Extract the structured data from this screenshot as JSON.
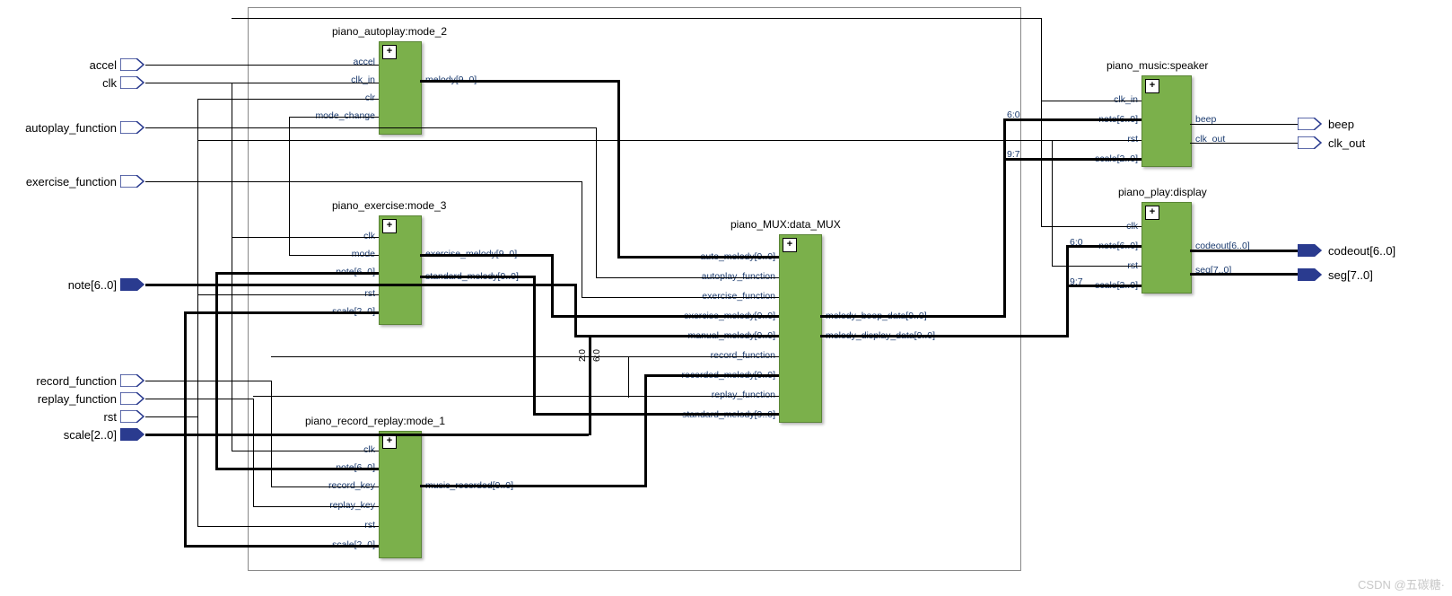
{
  "inputs": {
    "accel": "accel",
    "clk": "clk",
    "autoplay_function": "autoplay_function",
    "exercise_function": "exercise_function",
    "note": "note[6..0]",
    "record_function": "record_function",
    "replay_function": "replay_function",
    "rst": "rst",
    "scale": "scale[2..0]"
  },
  "outputs": {
    "beep": "beep",
    "clk_out": "clk_out",
    "codeout": "codeout[6..0]",
    "seg": "seg[7..0]"
  },
  "blocks": {
    "autoplay": {
      "title": "piano_autoplay:mode_2",
      "in": [
        "accel",
        "clk_in",
        "clr",
        "mode_change"
      ],
      "out": [
        "melody[9..0]"
      ]
    },
    "exercise": {
      "title": "piano_exercise:mode_3",
      "in": [
        "clk",
        "mode",
        "note[6..0]",
        "rst",
        "scale[2..0]"
      ],
      "out": [
        "exercise_melody[9..0]",
        "standard_melody[9..0]"
      ]
    },
    "record": {
      "title": "piano_record_replay:mode_1",
      "in": [
        "clk",
        "note[6..0]",
        "record_key",
        "replay_key",
        "rst",
        "scale[2..0]"
      ],
      "out": [
        "music_recorded[9..0]"
      ]
    },
    "mux": {
      "title": "piano_MUX:data_MUX",
      "in": [
        "auto_melody[9..0]",
        "autoplay_function",
        "exercise_function",
        "exercise_melody[9..0]",
        "manual_melody[9..0]",
        "record_function",
        "recorded_melody[9..0]",
        "replay_function",
        "standard_melody[9..0]"
      ],
      "out": [
        "melody_beep_data[9..0]",
        "melody_display_data[9..0]"
      ]
    },
    "speaker": {
      "title": "piano_music:speaker",
      "in": [
        "clk_in",
        "note[6..0]",
        "rst",
        "scale[2..0]"
      ],
      "out": [
        "beep",
        "clk_out"
      ]
    },
    "display": {
      "title": "piano_play:display",
      "in": [
        "clk",
        "note[6..0]",
        "rst",
        "scale[2..0]"
      ],
      "out": [
        "codeout[6..0]",
        "seg[7..0]"
      ]
    }
  },
  "bus_labels": {
    "b60a": "6:0",
    "b97a": "9:7",
    "b60b": "6:0",
    "b97b": "9:7",
    "b20": "2:0",
    "b60c": "6:0"
  },
  "watermark": "CSDN @五碳糖·"
}
